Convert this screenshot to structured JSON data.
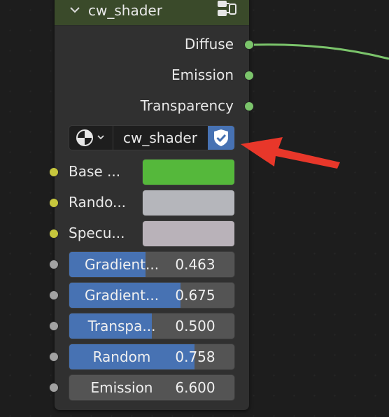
{
  "node": {
    "title": "cw_shader",
    "header_color": "#3a4a2a",
    "collapse_icon": "chevron-down-icon",
    "group_icon": "node-group-icon"
  },
  "outputs": [
    {
      "label": "Diffuse",
      "socket_color": "#7bc46b",
      "linked": true
    },
    {
      "label": "Emission",
      "socket_color": "#7bc46b",
      "linked": false
    },
    {
      "label": "Transparency",
      "socket_color": "#7bc46b",
      "linked": false
    }
  ],
  "material_selector": {
    "preview_icon": "material-sphere-icon",
    "dropdown_icon": "chevron-down-icon",
    "name": "cw_shader",
    "fake_user_icon": "shield-check-icon",
    "fake_user_active": true
  },
  "color_inputs": [
    {
      "label": "Base ...",
      "color": "#55b83b",
      "socket_color": "#c7c73d"
    },
    {
      "label": "Rando...",
      "color": "#b5b6bb",
      "socket_color": "#c7c73d"
    },
    {
      "label": "Specu...",
      "color": "#b9b2b9",
      "socket_color": "#c7c73d"
    }
  ],
  "value_inputs": [
    {
      "label": "Gradient...",
      "value": "0.463",
      "fill": 0.463
    },
    {
      "label": "Gradient...",
      "value": "0.675",
      "fill": 0.675
    },
    {
      "label": "Transpa...",
      "value": "0.500",
      "fill": 0.5
    },
    {
      "label": "Random",
      "value": "0.758",
      "fill": 0.758
    },
    {
      "label": "Emission",
      "value": "6.600",
      "fill": 0
    }
  ],
  "annotation": {
    "type": "arrow",
    "color": "#e8372a"
  },
  "link_color": "#7bc46b"
}
